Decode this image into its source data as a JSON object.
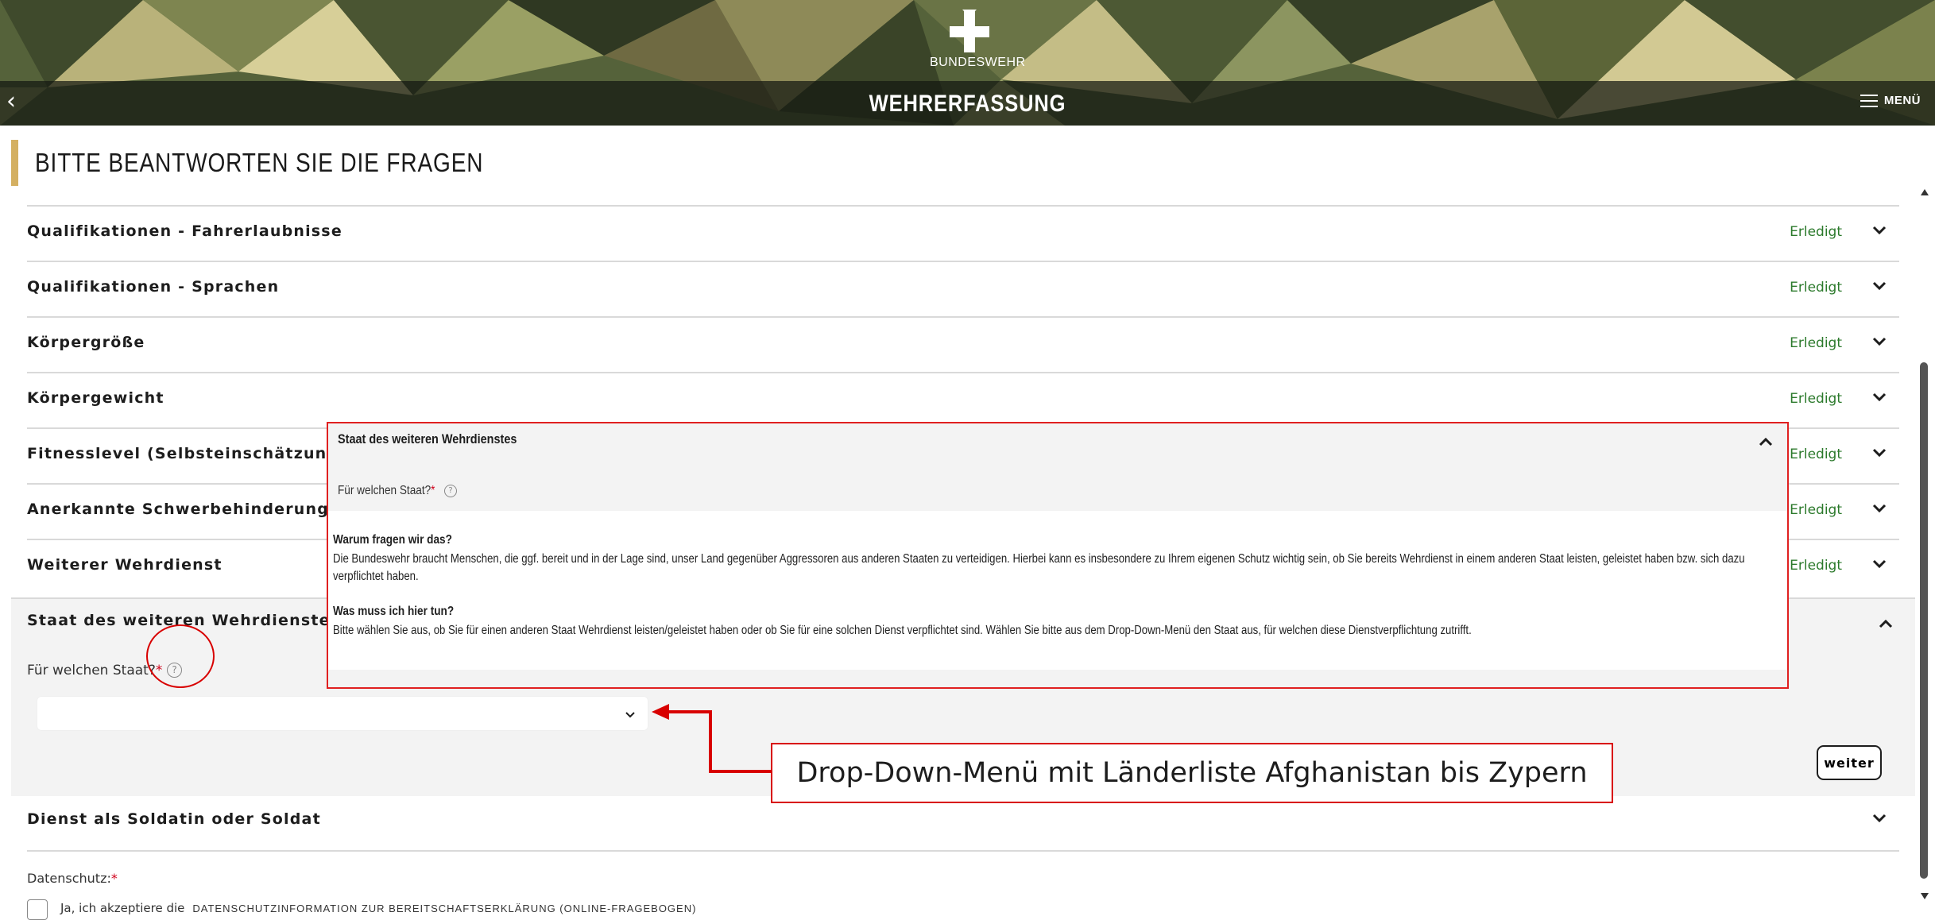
{
  "header": {
    "brand": "BUNDESWEHR",
    "title": "WEHRERFASSUNG",
    "menu_label": "MENÜ",
    "back_icon": "chevron-left-icon",
    "menu_icon": "hamburger-icon"
  },
  "page": {
    "heading": "BITTE BEANTWORTEN SIE DIE FRAGEN",
    "accent_color": "#d4b062"
  },
  "sections": [
    {
      "label": "Qualifikationen - Fahrerlaubnisse",
      "status": "Erledigt"
    },
    {
      "label": "Qualifikationen - Sprachen",
      "status": "Erledigt"
    },
    {
      "label": "Körpergröße",
      "status": "Erledigt"
    },
    {
      "label": "Körpergewicht",
      "status": "Erledigt"
    },
    {
      "label": "Fitnesslevel (Selbsteinschätzung)",
      "status": "Erledigt"
    },
    {
      "label": "Anerkannte Schwerbehinderung",
      "status": "Erledigt"
    },
    {
      "label": "Weiterer Wehrdienst",
      "status": "Erledigt"
    }
  ],
  "status_color": "#2c7a2c",
  "expanded": {
    "title": "Staat des weiteren Wehrdienstes",
    "question": "Für welchen Staat?",
    "required_mark": "*",
    "help_icon": "question-circle-icon",
    "select_value": "",
    "next_button": "weiter"
  },
  "next_section": {
    "label": "Dienst als Soldatin oder Soldat"
  },
  "privacy": {
    "label": "Datenschutz:",
    "required_mark": "*",
    "consent_text": "Ja, ich akzeptiere die",
    "consent_link": "DATENSCHUTZINFORMATION ZUR BEREITSCHAFTSERKLÄRUNG (ONLINE-FRAGEBOGEN)"
  },
  "popup": {
    "title": "Staat des weiteren Wehrdienstes",
    "question": "Für welchen Staat?",
    "required_mark": "*",
    "why_heading": "Warum fragen wir das?",
    "why_text": "Die Bundeswehr braucht Menschen, die ggf. bereit und in der Lage sind, unser Land gegenüber Aggressoren aus anderen Staaten zu verteidigen. Hierbei kann es insbesondere zu Ihrem eigenen Schutz wichtig sein, ob Sie bereits Wehrdienst in einem anderen Staat leisten, geleistet haben bzw. sich dazu verpflichtet haben.",
    "todo_heading": "Was muss ich hier tun?",
    "todo_text": "Bitte wählen Sie aus, ob Sie für einen anderen Staat Wehrdienst leisten/geleistet haben oder ob Sie für eine solchen Dienst verpflichtet sind. Wählen Sie bitte aus dem Drop-Down-Menü den Staat aus, für welchen diese Dienstverpflichtung zutrifft."
  },
  "annotation": {
    "text": "Drop-Down-Menü mit Länderliste Afghanistan bis Zypern",
    "color": "#d80000"
  }
}
